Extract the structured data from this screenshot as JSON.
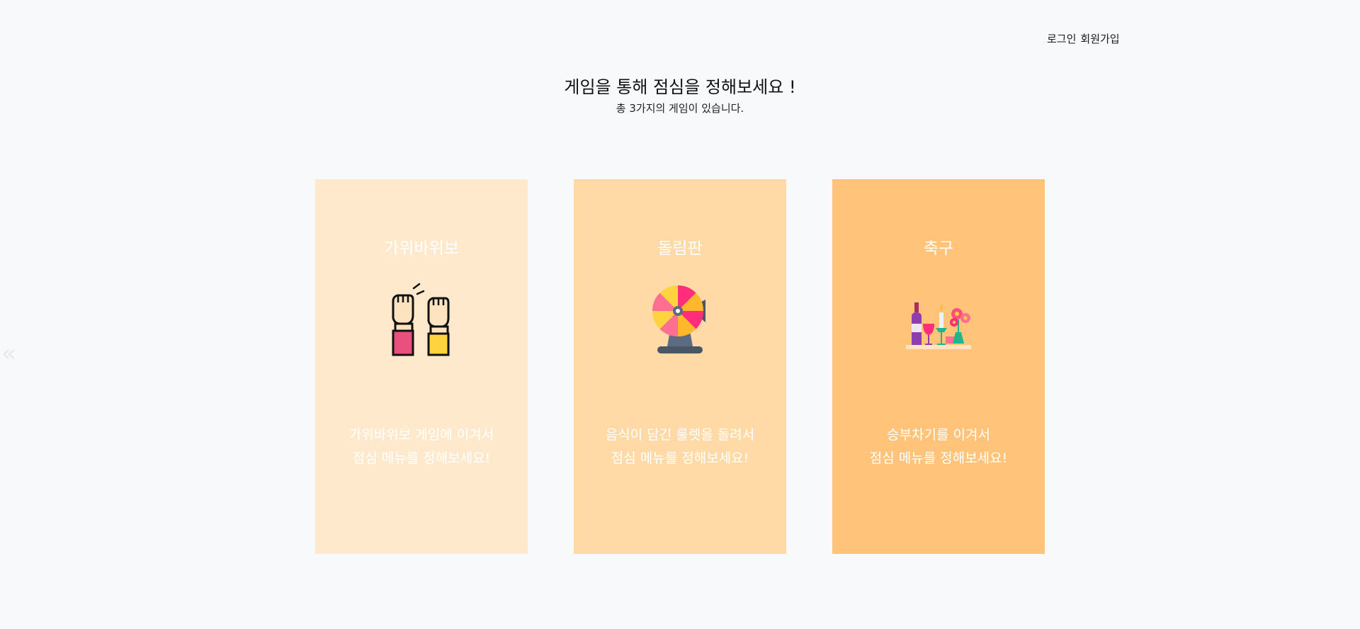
{
  "header": {
    "login_label": "로그인",
    "signup_label": "회원가입"
  },
  "hero": {
    "title": "게임을 통해 점심을 정해보세요 !",
    "subtitle": "총 3가지의 게임이 있습니다."
  },
  "carousel": {
    "prev_icon": "double-chevron-left-icon"
  },
  "games": [
    {
      "title": "가위바위보",
      "icon": "rock-paper-scissors-hands-icon",
      "desc_line1": "가위바위보 게임에 이겨서",
      "desc_line2": "점심 메뉴를 정해보세요!",
      "color": "#ffe9cc"
    },
    {
      "title": "돌림판",
      "icon": "roulette-wheel-icon",
      "desc_line1": "음식이 담긴 룰렛을 돌려서",
      "desc_line2": "점심 메뉴를 정해보세요!",
      "color": "#ffdaa6"
    },
    {
      "title": "축구",
      "icon": "celebration-table-icon",
      "desc_line1": "승부차기를 이겨서",
      "desc_line2": "점심 메뉴를 정해보세요!",
      "color": "#ffc37a"
    }
  ]
}
